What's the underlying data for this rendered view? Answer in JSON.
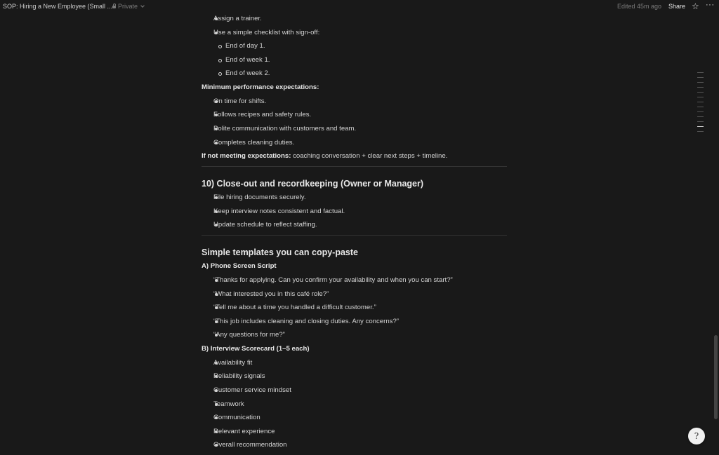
{
  "topbar": {
    "title": "SOP: Hiring a New Employee (Small ...",
    "privacy": "Private",
    "edited": "Edited 45m ago",
    "share": "Share",
    "star_icon": "star-icon",
    "more_icon": "more-icon"
  },
  "content": {
    "trainer": "Assign a trainer.",
    "checklist": "Use a simple checklist with sign-off:",
    "sub": [
      "End of day 1.",
      "End of week 1.",
      "End of week 2."
    ],
    "min_title": "Minimum performance expectations:",
    "min_items": [
      "On time for shifts.",
      "Follows recipes and safety rules.",
      "Polite communication with customers and team.",
      "Completes cleaning duties."
    ],
    "not_meeting_bold": "If not meeting expectations:",
    "not_meeting_text": " coaching conversation + clear next steps + timeline.",
    "sec10_heading": "10) Close-out and recordkeeping (Owner or Manager)",
    "sec10_items": [
      "File hiring documents securely.",
      "Keep interview notes consistent and factual.",
      "Update schedule to reflect staffing."
    ],
    "templates_heading": "Simple templates you can copy-paste",
    "phone_title": "A) Phone Screen Script",
    "phone_items": [
      "“Thanks for applying. Can you confirm your availability and when you can start?”",
      "“What interested you in this café role?”",
      "“Tell me about a time you handled a difficult customer.”",
      "“This job includes cleaning and closing duties. Any concerns?”",
      "“Any questions for me?”"
    ],
    "score_title": "B) Interview Scorecard (1–5 each)",
    "score_items": [
      "Availability fit",
      "Reliability signals",
      "Customer service mindset",
      "Teamwork",
      "Communication",
      "Relevant experience",
      "Overall recommendation"
    ]
  },
  "help": {
    "icon": "help-icon",
    "glyph": "?"
  }
}
